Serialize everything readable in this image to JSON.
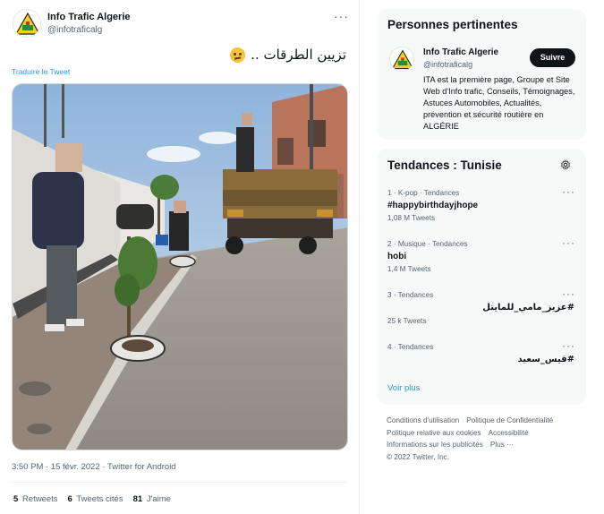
{
  "tweet": {
    "author_name": "Info Trafic Algerie",
    "author_handle": "@infotraficalg",
    "avatar_icon": "road-sign-logo",
    "more_icon": "more-dots-icon",
    "text": "تزيين الطرقات ..",
    "emoji_icon": "thinking-face-emoji",
    "translate_label": "Traduire le Tweet",
    "timestamp": "3:50 PM · 15 févr. 2022 · Twitter for Android",
    "stats": [
      {
        "count": "5",
        "label": "Retweets"
      },
      {
        "count": "6",
        "label": "Tweets cités"
      },
      {
        "count": "81",
        "label": "J'aime"
      }
    ]
  },
  "who_to_follow": {
    "title": "Personnes pertinentes",
    "name": "Info Trafic Algerie",
    "handle": "@infotraficalg",
    "follow_label": "Suivre",
    "bio": "ITA est la première page, Groupe et Site Web d'Info trafic, Conseils, Témoignages, Astuces Automobiles, Actualités, prévention et sécurité routière en ALGÉRIE"
  },
  "trends": {
    "title": "Tendances : Tunisie",
    "settings_icon": "gear-icon",
    "items": [
      {
        "meta": "1 · K-pop · Tendances",
        "name": "#happybirthdayjhope",
        "count": "1,08 M Tweets",
        "rtl": false
      },
      {
        "meta": "2 · Musique · Tendances",
        "name": "hobi",
        "count": "1,4 M Tweets",
        "rtl": false
      },
      {
        "meta": "3 · Tendances",
        "name": "#عزيز_مامي_للمايتل",
        "count": "25 k Tweets",
        "rtl": true
      },
      {
        "meta": "4 · Tendances",
        "name": "#قيس_سعيد",
        "count": "",
        "rtl": true
      }
    ],
    "show_more": "Voir plus"
  },
  "footer": {
    "links": [
      "Conditions d'utilisation",
      "Politique de Confidentialité",
      "Politique relative aux cookies",
      "Accessibilité",
      "Informations sur les publicités",
      "Plus ···"
    ],
    "copyright": "© 2022 Twitter, Inc."
  },
  "colors": {
    "accent": "#1d9bf0",
    "text_primary": "#0f1419",
    "text_secondary": "#536471",
    "card_bg": "#f7f9f9",
    "logo_yellow": "#f2d21b"
  }
}
